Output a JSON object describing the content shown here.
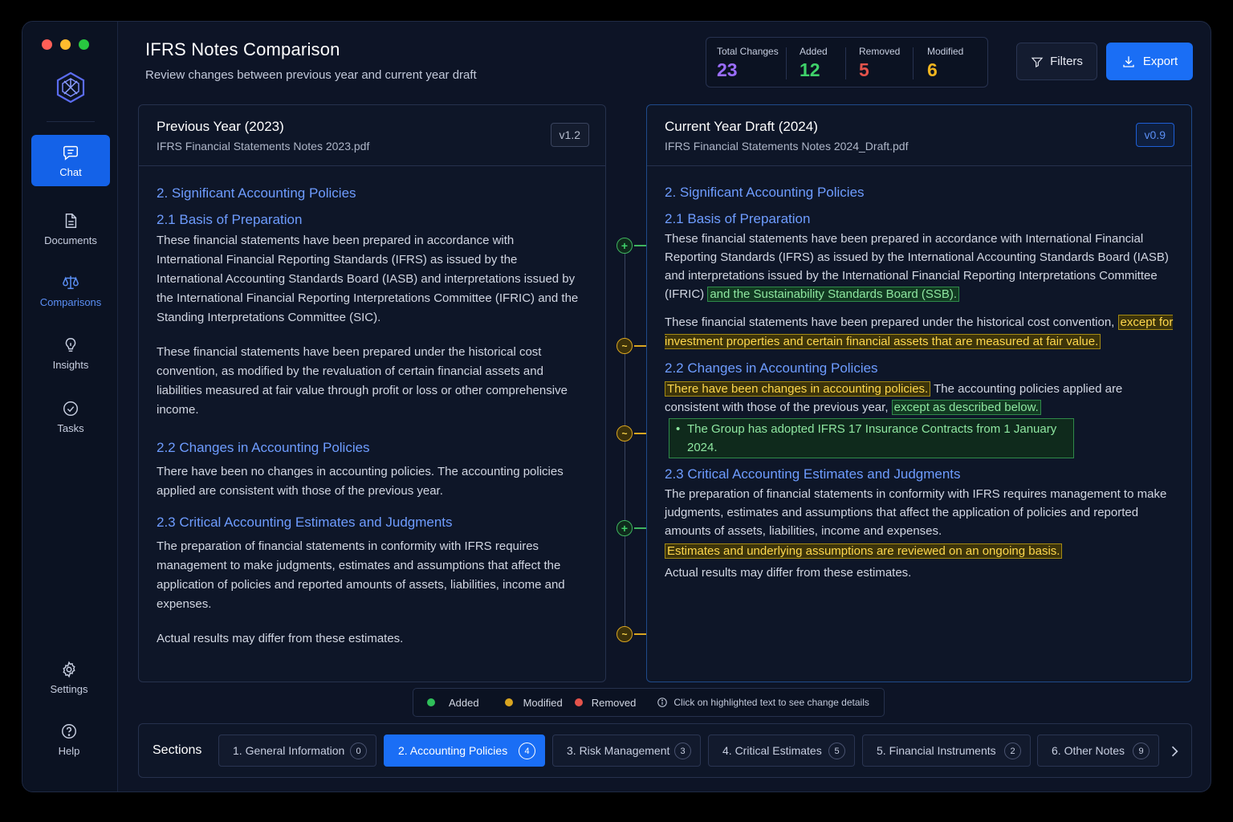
{
  "colors": {
    "accent": "#1a6ef5",
    "added": "#3fd16a",
    "modified": "#d9a520",
    "removed": "#e5534b",
    "total": "#9b6dff"
  },
  "sidebar": {
    "items": [
      {
        "label": "Chat",
        "icon": "chat-icon"
      },
      {
        "label": "Documents",
        "icon": "document-icon"
      },
      {
        "label": "Comparisons",
        "icon": "scale-icon"
      },
      {
        "label": "Insights",
        "icon": "lightbulb-icon"
      },
      {
        "label": "Tasks",
        "icon": "check-circle-icon"
      }
    ],
    "bottom": [
      {
        "label": "Settings",
        "icon": "gear-icon"
      },
      {
        "label": "Help",
        "icon": "help-icon"
      }
    ]
  },
  "header": {
    "title": "IFRS Notes Comparison",
    "subtitle": "Review changes between previous year and current year draft"
  },
  "stats": {
    "total_label": "Total Changes",
    "total": "23",
    "added_label": "Added",
    "added": "12",
    "removed_label": "Removed",
    "removed": "5",
    "modified_label": "Modified",
    "modified": "6"
  },
  "toolbar": {
    "filters": "Filters",
    "export": "Export"
  },
  "left": {
    "title": "Previous Year (2023)",
    "file": "IFRS Financial Statements Notes 2023.pdf",
    "version": "v1.2",
    "h_policies": "2. Significant Accounting Policies",
    "h_basis": "2.1 Basis of Preparation",
    "p_basis_1": "These financial statements have been prepared in accordance with International Financial Reporting Standards (IFRS) as issued by the International Accounting Standards Board (IASB) and interpretations issued by the International Financial Reporting Interpretations Committee (IFRIC) and the Standing Interpretations Committee (SIC).",
    "p_basis_2": "These financial statements have been prepared under the historical cost convention, as modified by the revaluation of certain financial assets and liabilities measured at fair value through profit or loss or other comprehensive income.",
    "h_changes": "2.2 Changes in Accounting Policies",
    "p_changes": "There have been no changes in accounting policies. The accounting policies applied are consistent with those of the previous year.",
    "h_critical": "2.3 Critical Accounting Estimates and Judgments",
    "p_critical": "The preparation of financial statements in conformity with IFRS requires management to make judgments, estimates and assumptions that affect the application of policies and reported amounts of assets, liabilities, income and expenses.",
    "p_actual": "Actual results may differ from these estimates."
  },
  "right": {
    "title": "Current Year Draft (2024)",
    "file": "IFRS Financial Statements Notes 2024_Draft.pdf",
    "version": "v0.9",
    "h_policies": "2. Significant Accounting Policies",
    "h_basis": "2.1 Basis of Preparation",
    "p_basis_1": "These financial statements have been prepared in accordance with International Financial Reporting Standards (IFRS) as issued by the International Accounting Standards Board (IASB) and interpretations issued by the International Financial Reporting Interpretations Committee (IFRIC)",
    "p_basis_1_added": "and the Sustainability Standards Board (SSB).",
    "p_basis_2": "These financial statements have been prepared under the historical cost convention,",
    "p_basis_2_mod": "except for investment properties and certain financial assets that are measured at fair value.",
    "h_changes": "2.2 Changes in Accounting Policies",
    "p_changes_mod": "There have been changes in accounting policies.",
    "p_changes": "The accounting policies applied are consistent with those of the previous year,",
    "p_changes_added": "except as described below.",
    "bullet_added": "The Group has adopted IFRS 17 Insurance Contracts from 1 January 2024.",
    "h_critical": "2.3 Critical Accounting Estimates and Judgments",
    "p_critical": "The preparation of financial statements in conformity with IFRS requires management to make judgments, estimates and assumptions that affect the application of policies and reported amounts of assets, liabilities, income and expenses.",
    "p_estimates_mod": "Estimates and underlying assumptions are reviewed on an ongoing basis.",
    "p_actual": "Actual results may differ from these estimates."
  },
  "markers": [
    {
      "type": "add",
      "symbol": "+"
    },
    {
      "type": "mod",
      "symbol": "~"
    },
    {
      "type": "mod",
      "symbol": "~"
    },
    {
      "type": "add",
      "symbol": "+"
    },
    {
      "type": "mod",
      "symbol": "~"
    }
  ],
  "legend": {
    "added": "Added",
    "modified": "Modified",
    "removed": "Removed",
    "info": "Click on highlighted text to see change details"
  },
  "sections": {
    "label": "Sections",
    "tabs": [
      {
        "label": "1. General Information",
        "count": "0"
      },
      {
        "label": "2. Accounting Policies",
        "count": "4"
      },
      {
        "label": "3. Risk Management",
        "count": "3"
      },
      {
        "label": "4. Critical Estimates",
        "count": "5"
      },
      {
        "label": "5. Financial Instruments",
        "count": "2"
      },
      {
        "label": "6. Other Notes",
        "count": "9"
      }
    ]
  }
}
